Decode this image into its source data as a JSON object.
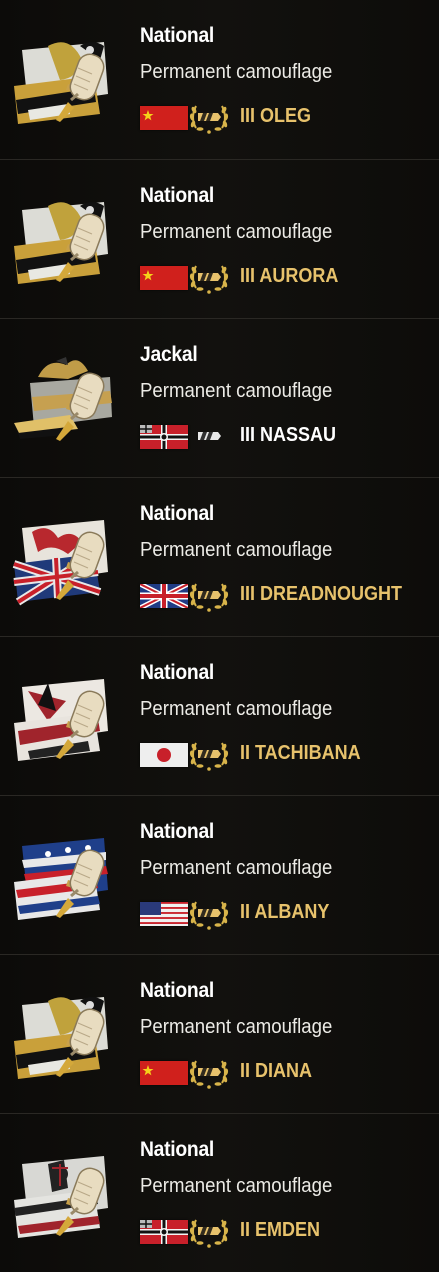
{
  "items": [
    {
      "title": "National",
      "subtitle": "Permanent camouflage",
      "tier": "III",
      "ship": "OLEG",
      "nation": "China",
      "camo": "gold-white",
      "premium": true,
      "colors": {
        "name": "#e7c26c"
      }
    },
    {
      "title": "National",
      "subtitle": "Permanent camouflage",
      "tier": "III",
      "ship": "AURORA",
      "nation": "China",
      "camo": "gold-white",
      "premium": true,
      "colors": {
        "name": "#e7c26c"
      }
    },
    {
      "title": "Jackal",
      "subtitle": "Permanent camouflage",
      "tier": "III",
      "ship": "NASSAU",
      "nation": "Germany",
      "camo": "jackal",
      "premium": false,
      "colors": {
        "name": "#ffffff"
      }
    },
    {
      "title": "National",
      "subtitle": "Permanent camouflage",
      "tier": "III",
      "ship": "DREADNOUGHT",
      "nation": "United Kingdom",
      "camo": "uk",
      "premium": true,
      "colors": {
        "name": "#e7c26c"
      }
    },
    {
      "title": "National",
      "subtitle": "Permanent camouflage",
      "tier": "II",
      "ship": "TACHIBANA",
      "nation": "Japan",
      "camo": "japan",
      "premium": true,
      "colors": {
        "name": "#e7c26c"
      }
    },
    {
      "title": "National",
      "subtitle": "Permanent camouflage",
      "tier": "II",
      "ship": "ALBANY",
      "nation": "USA",
      "camo": "usa",
      "premium": true,
      "colors": {
        "name": "#e7c26c"
      }
    },
    {
      "title": "National",
      "subtitle": "Permanent camouflage",
      "tier": "II",
      "ship": "DIANA",
      "nation": "China",
      "camo": "gold-white",
      "premium": true,
      "colors": {
        "name": "#e7c26c"
      }
    },
    {
      "title": "National",
      "subtitle": "Permanent camouflage",
      "tier": "II",
      "ship": "EMDEN",
      "nation": "Germany",
      "camo": "germany",
      "premium": true,
      "colors": {
        "name": "#e7c26c"
      }
    }
  ],
  "icons": {
    "thumbnail": "camouflage-paint-roller-icon",
    "class": "cruiser-class-icon",
    "premium": "laurel-wreath-icon"
  }
}
